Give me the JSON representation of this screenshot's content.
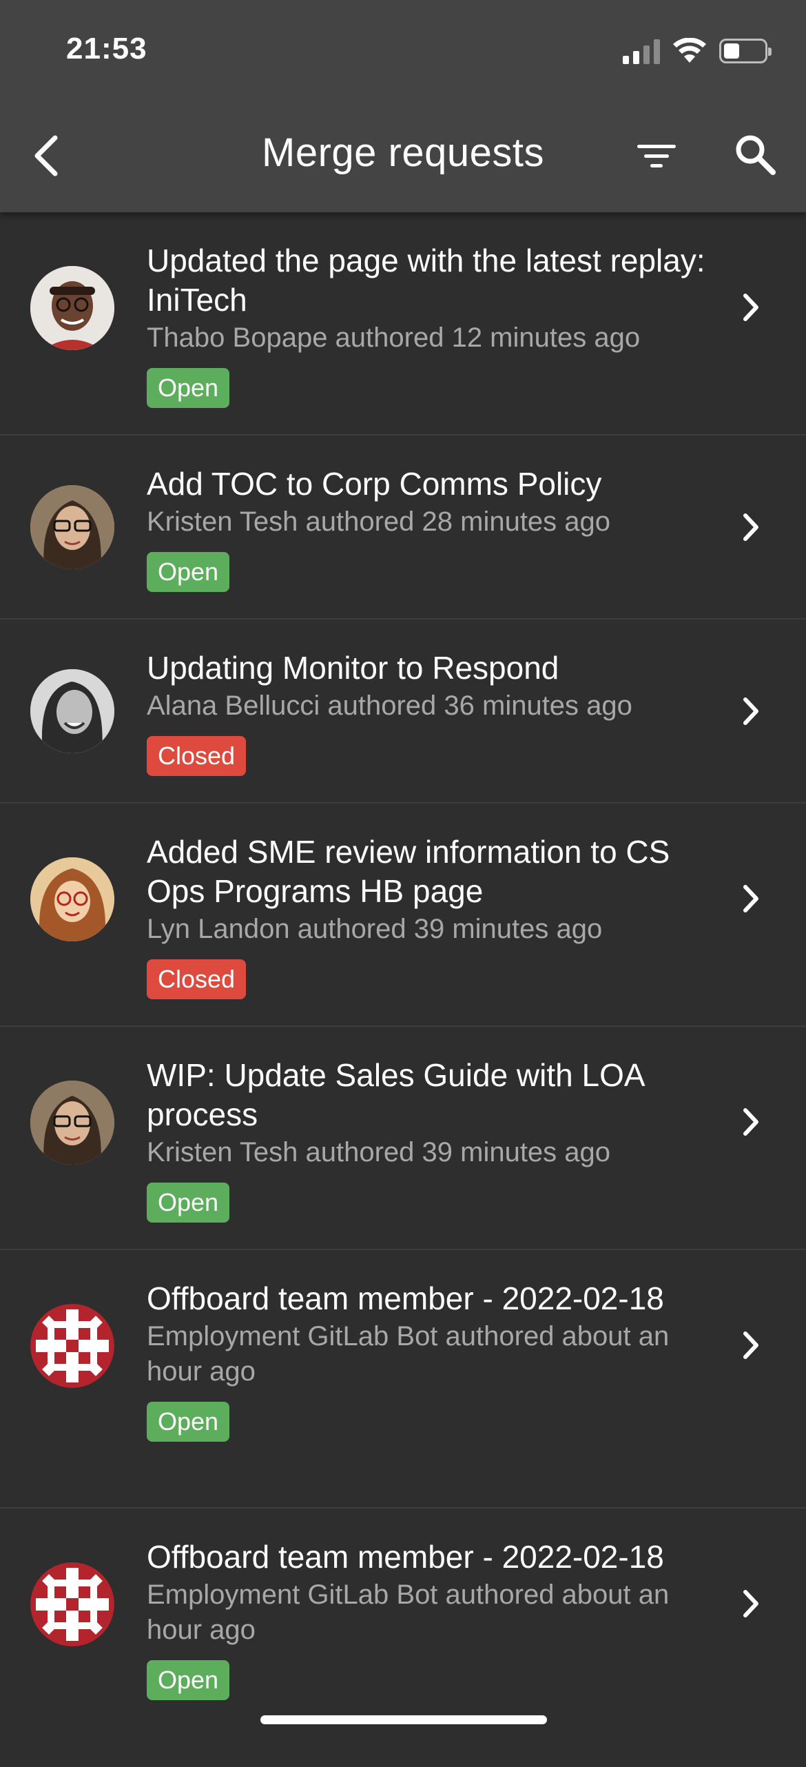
{
  "status_bar": {
    "time": "21:53"
  },
  "nav": {
    "title": "Merge requests"
  },
  "items": [
    {
      "title": "Updated the page with the latest replay: IniTech",
      "meta": "Thabo Bopape authored 12 minutes ago",
      "status": "Open"
    },
    {
      "title": "Add TOC to Corp Comms Policy",
      "meta": "Kristen Tesh authored 28 minutes ago",
      "status": "Open"
    },
    {
      "title": "Updating Monitor to Respond",
      "meta": "Alana Bellucci authored 36 minutes ago",
      "status": "Closed"
    },
    {
      "title": "Added SME review information to CS Ops Programs HB page",
      "meta": "Lyn Landon authored 39 minutes ago",
      "status": "Closed"
    },
    {
      "title": "WIP: Update Sales Guide with LOA process",
      "meta": "Kristen Tesh authored 39 minutes ago",
      "status": "Open"
    },
    {
      "title": "Offboard team member - 2022-02-18",
      "meta": "Employment GitLab Bot authored about an hour ago",
      "status": "Open"
    },
    {
      "title": "Offboard team member - 2022-02-18",
      "meta": "Employment GitLab Bot authored about an hour ago",
      "status": "Open"
    }
  ],
  "colors": {
    "open": "#5cae5c",
    "closed": "#de4b3e",
    "background": "#2e2e2e",
    "header": "#444444"
  }
}
